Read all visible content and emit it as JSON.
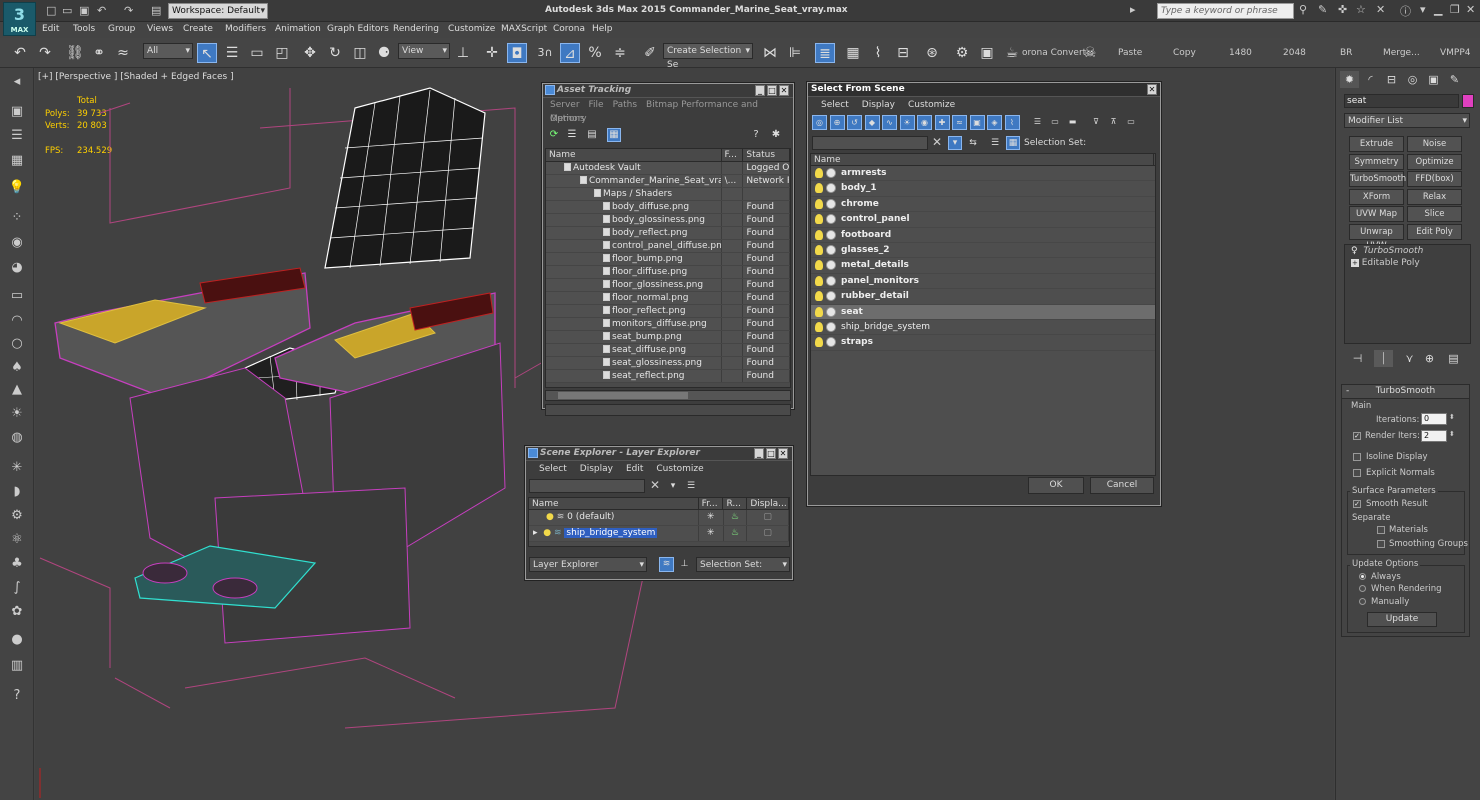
{
  "app": {
    "logo": "3",
    "logo_sub": "MAX",
    "workspace": "Workspace: Default",
    "title": "Autodesk 3ds Max  2015    Commander_Marine_Seat_vray.max",
    "search_placeholder": "Type a keyword or phrase"
  },
  "menu": [
    "Edit",
    "Tools",
    "Group",
    "Views",
    "Create",
    "Modifiers",
    "Animation",
    "Graph Editors",
    "Rendering",
    "Customize",
    "MAXScript",
    "Corona",
    "Help"
  ],
  "toolbar": {
    "filter": "All",
    "ref_coord": "View",
    "selection_set": "Create Selection Se",
    "snap_3": "3",
    "text_buttons": [
      "orona Convert",
      "Paste",
      "Copy",
      "1480",
      "2048",
      "BR",
      "Merge...",
      "VMPP4"
    ]
  },
  "viewport": {
    "label": "[+] [Perspective ] [Shaded + Edged Faces ]",
    "stats": {
      "total_label": "Total",
      "polys_label": "Polys:",
      "polys": "39 733",
      "verts_label": "Verts:",
      "verts": "20 803",
      "fps_label": "FPS:",
      "fps": "234.529"
    }
  },
  "asset_tracking": {
    "title": "Asset Tracking",
    "menu": [
      "Server",
      "File",
      "Paths",
      "Bitmap Performance and Memory"
    ],
    "menu2": "Options",
    "columns": [
      "Name",
      "F...",
      "Status"
    ],
    "rows": [
      {
        "name": "Autodesk Vault",
        "f": "",
        "status": "Logged Ou"
      },
      {
        "name": "Commander_Marine_Seat_vray....",
        "f": "\\...",
        "status": "Network Pa"
      },
      {
        "name": "Maps / Shaders",
        "f": "",
        "status": ""
      },
      {
        "name": "body_diffuse.png",
        "f": "",
        "status": "Found"
      },
      {
        "name": "body_glossiness.png",
        "f": "",
        "status": "Found"
      },
      {
        "name": "body_reflect.png",
        "f": "",
        "status": "Found"
      },
      {
        "name": "control_panel_diffuse.png",
        "f": "",
        "status": "Found"
      },
      {
        "name": "floor_bump.png",
        "f": "",
        "status": "Found"
      },
      {
        "name": "floor_diffuse.png",
        "f": "",
        "status": "Found"
      },
      {
        "name": "floor_glossiness.png",
        "f": "",
        "status": "Found"
      },
      {
        "name": "floor_normal.png",
        "f": "",
        "status": "Found"
      },
      {
        "name": "floor_reflect.png",
        "f": "",
        "status": "Found"
      },
      {
        "name": "monitors_diffuse.png",
        "f": "",
        "status": "Found"
      },
      {
        "name": "seat_bump.png",
        "f": "",
        "status": "Found"
      },
      {
        "name": "seat_diffuse.png",
        "f": "",
        "status": "Found"
      },
      {
        "name": "seat_glossiness.png",
        "f": "",
        "status": "Found"
      },
      {
        "name": "seat_reflect.png",
        "f": "",
        "status": "Found"
      }
    ]
  },
  "select_from_scene": {
    "title": "Select From Scene",
    "menu": [
      "Select",
      "Display",
      "Customize"
    ],
    "selection_set_label": "Selection Set:",
    "column": "Name",
    "items": [
      {
        "name": "armrests"
      },
      {
        "name": "body_1"
      },
      {
        "name": "chrome"
      },
      {
        "name": "control_panel"
      },
      {
        "name": "footboard"
      },
      {
        "name": "glasses_2"
      },
      {
        "name": "metal_details"
      },
      {
        "name": "panel_monitors"
      },
      {
        "name": "rubber_detail"
      },
      {
        "name": "seat"
      },
      {
        "name": "ship_bridge_system"
      },
      {
        "name": "straps"
      }
    ],
    "ok": "OK",
    "cancel": "Cancel"
  },
  "scene_explorer": {
    "title": "Scene Explorer - Layer Explorer",
    "menu": [
      "Select",
      "Display",
      "Edit",
      "Customize"
    ],
    "columns": [
      "Name",
      "Fr...",
      "R...",
      "Displa..."
    ],
    "layers": [
      {
        "name": "0 (default)"
      },
      {
        "name": "ship_bridge_system"
      }
    ],
    "footer_dropdown": "Layer Explorer",
    "footer_selection": "Selection Set:"
  },
  "command_panel": {
    "object_name": "seat",
    "modifier_list": "Modifier List",
    "buttons": [
      "Extrude",
      "Noise",
      "Symmetry",
      "Optimize",
      "TurboSmooth",
      "FFD(box)",
      "XForm",
      "Relax",
      "UVW Map",
      "Slice",
      "Unwrap UVW",
      "Edit Poly"
    ],
    "stack": [
      "TurboSmooth",
      "Editable Poly"
    ],
    "rollout_title": "TurboSmooth",
    "main_label": "Main",
    "iterations_label": "Iterations:",
    "iterations": "0",
    "render_iters_label": "Render Iters:",
    "render_iters": "2",
    "isoline": "Isoline Display",
    "explicit_normals": "Explicit Normals",
    "surface_params": "Surface Parameters",
    "smooth_result": "Smooth Result",
    "separate": "Separate",
    "materials": "Materials",
    "smoothing_groups": "Smoothing Groups",
    "update_options": "Update Options",
    "always": "Always",
    "when_rendering": "When Rendering",
    "manually": "Manually",
    "update": "Update"
  }
}
